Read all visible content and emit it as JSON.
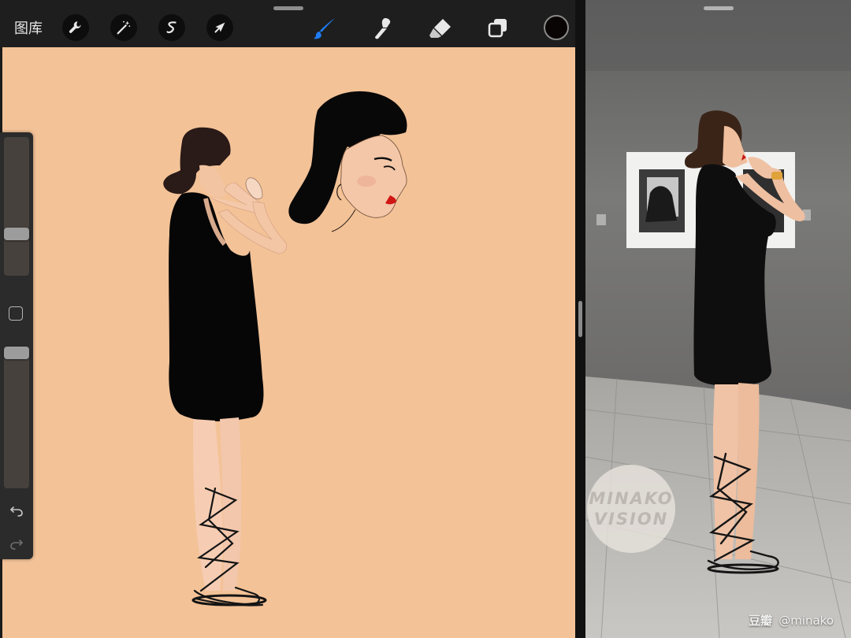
{
  "toolbar": {
    "gallery_label": "图库",
    "tools": [
      {
        "name": "actions",
        "icon": "wrench-icon"
      },
      {
        "name": "adjustments",
        "icon": "magic-wand-icon"
      },
      {
        "name": "selection",
        "icon": "selection-icon"
      },
      {
        "name": "transform",
        "icon": "arrow-cursor-icon"
      }
    ],
    "paint_tools": [
      {
        "name": "brush",
        "icon": "brush-icon",
        "active": true
      },
      {
        "name": "smudge",
        "icon": "smudge-icon",
        "active": false
      },
      {
        "name": "eraser",
        "icon": "eraser-icon",
        "active": false
      },
      {
        "name": "layers",
        "icon": "layers-icon",
        "active": false
      }
    ],
    "current_color": "#0a0505",
    "active_color": "#1e7cf2"
  },
  "sidebar": {
    "brush_size_level": 0.72,
    "opacity_level": 0.0
  },
  "canvas": {
    "background": "#f3c297"
  },
  "photo": {
    "watermark_lines": [
      "MINAKO",
      "VISION"
    ],
    "credit_site": "豆瓣",
    "credit_user": "@minako"
  }
}
